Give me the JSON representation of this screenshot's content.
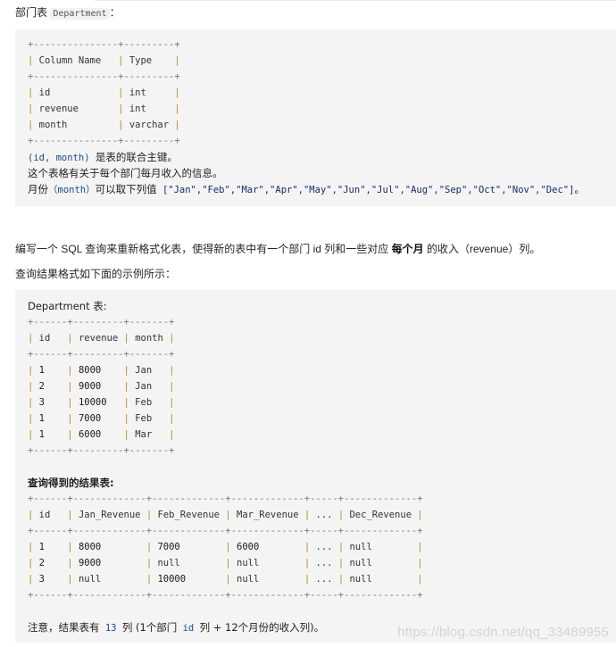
{
  "intro": {
    "label": "部门表",
    "table_name": "Department",
    "suffix": "："
  },
  "schema_table": {
    "border": "+---------------+---------+",
    "headers": [
      "Column Name",
      "Type"
    ],
    "rows": [
      [
        "id",
        "int"
      ],
      [
        "revenue",
        "int"
      ],
      [
        "month",
        "varchar"
      ]
    ]
  },
  "schema_notes": {
    "pk_code": "(id, month)",
    "pk_text": "是表的联合主键。",
    "desc": "这个表格有关于每个部门每月收入的信息。",
    "month_label": "月份",
    "month_code": "（month）",
    "month_text": "可以取下列值",
    "month_values": "[\"Jan\",\"Feb\",\"Mar\",\"Apr\",\"May\",\"Jun\",\"Jul\",\"Aug\",\"Sep\",\"Oct\",\"Nov\",\"Dec\"]",
    "month_end": "。"
  },
  "task": {
    "before": "编写一个 SQL 查询来重新格式化表，使得新的表中有一个部门 id 列和一些对应",
    "bold": "每个月",
    "after": "的收入（revenue）列。",
    "format_line": "查询结果格式如下面的示例所示："
  },
  "example_input": {
    "title": "Department 表:",
    "border": "+------+---------+-------+",
    "headers": [
      "id",
      "revenue",
      "month"
    ],
    "rows": [
      [
        "1",
        "8000",
        "Jan"
      ],
      [
        "2",
        "9000",
        "Jan"
      ],
      [
        "3",
        "10000",
        "Feb"
      ],
      [
        "1",
        "7000",
        "Feb"
      ],
      [
        "1",
        "6000",
        "Mar"
      ]
    ]
  },
  "example_output": {
    "title": "查询得到的结果表:",
    "border": "+------+-------------+-------------+-------------+-----+-------------+",
    "headers": [
      "id",
      "Jan_Revenue",
      "Feb_Revenue",
      "Mar_Revenue",
      "...",
      "Dec_Revenue"
    ],
    "rows": [
      [
        "1",
        "8000",
        "7000",
        "6000",
        "...",
        "null"
      ],
      [
        "2",
        "9000",
        "null",
        "null",
        "...",
        "null"
      ],
      [
        "3",
        "null",
        "10000",
        "null",
        "...",
        "null"
      ]
    ]
  },
  "note": {
    "prefix": "注意，结果表有",
    "count": "13",
    "mid": "列 (1个部门",
    "id_code": "id",
    "end": "列 + 12个月份的收入列)。"
  },
  "watermark": "https://blog.csdn.net/qq_33489955"
}
